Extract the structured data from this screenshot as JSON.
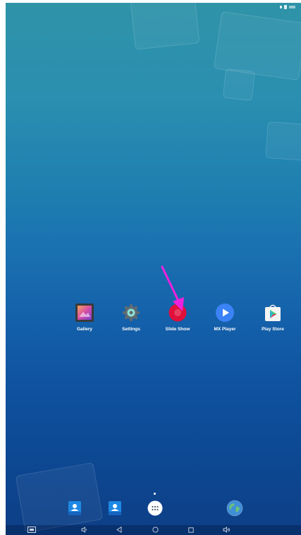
{
  "launcher": {
    "apps": [
      {
        "label": "Gallery",
        "icon": "gallery-icon"
      },
      {
        "label": "Settings",
        "icon": "gear-icon"
      },
      {
        "label": "Slide Show",
        "icon": "slide-show-icon"
      },
      {
        "label": "MX Player",
        "icon": "play-icon"
      },
      {
        "label": "Play Store",
        "icon": "play-store-icon"
      }
    ]
  },
  "dock": {
    "items": [
      {
        "icon": "contacts-icon"
      },
      {
        "icon": "contacts-icon"
      },
      {
        "icon": "app-drawer-icon"
      },
      {
        "icon": "globe-icon"
      }
    ]
  },
  "navbar": {
    "buttons": [
      "screenshot-icon",
      "volume-down-icon",
      "back-icon",
      "home-icon",
      "recents-icon",
      "volume-up-icon"
    ]
  },
  "colors": {
    "wallpaper_top": "#2f93a8",
    "wallpaper_bottom": "#0d3f86",
    "annotation_arrow": "#ee22dd",
    "slide_show_red": "#e0103a",
    "mx_player_blue": "#3b82f6"
  }
}
